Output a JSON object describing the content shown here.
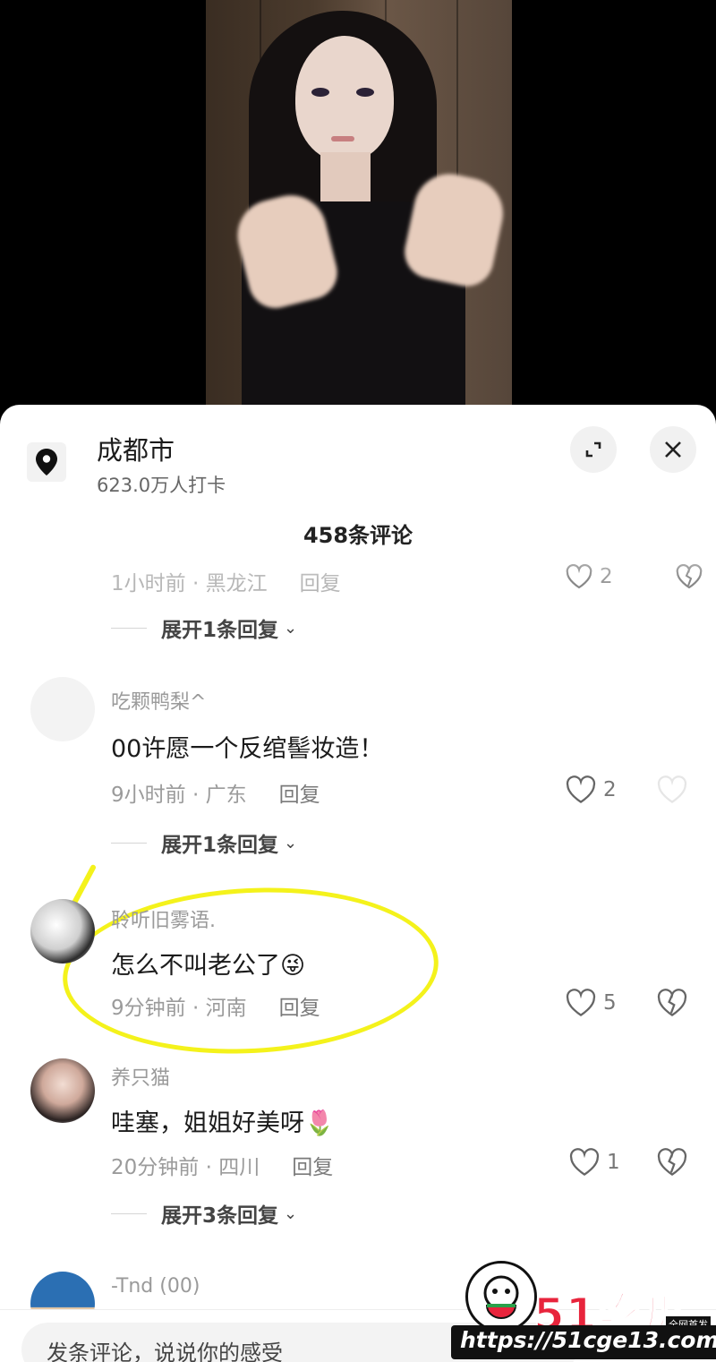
{
  "location": {
    "name": "成都市",
    "checkins": "623.0万人打卡"
  },
  "comment_count": "458条评论",
  "partial_comment": {
    "meta": "1小时前 · 黑龙江",
    "reply": "回复",
    "likes": "2"
  },
  "expand_1": "展开1条回复",
  "comments": [
    {
      "user": "吃颗鸭梨^",
      "text": "00许愿一个反绾髻妆造！",
      "time": "9小时前 · 广东",
      "reply": "回复",
      "likes": "2"
    },
    {
      "user": "聆听旧雾语.",
      "text": "怎么不叫老公了",
      "emoji": "😜",
      "time": "9分钟前 · 河南",
      "reply": "回复",
      "likes": "5"
    },
    {
      "user": "养只猫",
      "text": "哇塞，姐姐好美呀",
      "emoji": "🌷",
      "time": "20分钟前 · 四川",
      "reply": "回复",
      "likes": "1"
    },
    {
      "user": "-Tnd (00)"
    }
  ],
  "expand_2": "展开1条回复",
  "expand_3": "展开3条回复",
  "input_placeholder": "发条评论，说说你的感受",
  "watermark": {
    "logo": "51吃瓜",
    "tag": "全网首发",
    "url": "https://51cge13.com"
  },
  "colors": {
    "highlight": "#f4f21b",
    "watermark_red": "#e8243c"
  }
}
